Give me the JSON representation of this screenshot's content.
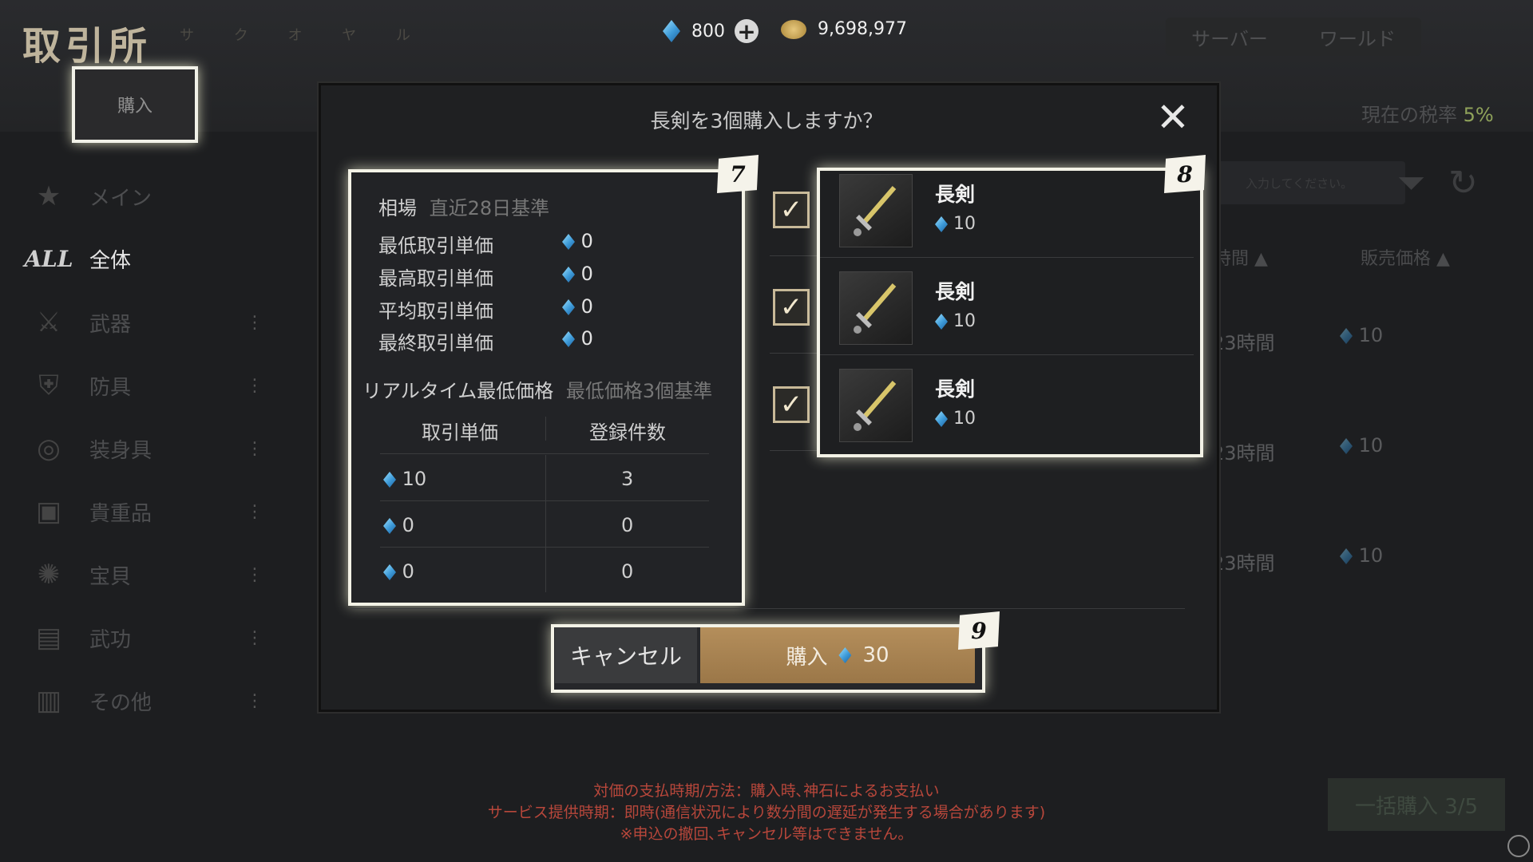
{
  "header": {
    "title": "取引所",
    "subglyph": "サ ク オ ヤ ル",
    "gems": "800",
    "gold": "9,698,977",
    "server_tab": "サーバー",
    "world_tab": "ワールド",
    "tax_label": "現在の税率",
    "tax_value": "5%"
  },
  "buy_tab": "購入",
  "sidebar": {
    "items": [
      {
        "label": "メイン",
        "icon": "star-icon"
      },
      {
        "label": "全体",
        "icon": "all-icon",
        "icon_text": "ALL"
      },
      {
        "label": "武器",
        "icon": "sword-icon"
      },
      {
        "label": "防具",
        "icon": "armor-icon"
      },
      {
        "label": "装身具",
        "icon": "accessory-icon"
      },
      {
        "label": "貴重品",
        "icon": "valuables-icon"
      },
      {
        "label": "宝貝",
        "icon": "treasure-icon"
      },
      {
        "label": "武功",
        "icon": "martial-arts-icon"
      },
      {
        "label": "その他",
        "icon": "other-icon"
      }
    ]
  },
  "background": {
    "search_placeholder": "入力してください。",
    "col_time": "時間",
    "col_price": "販売価格",
    "rows": [
      {
        "time": "23時間",
        "price": "10"
      },
      {
        "time": "23時間",
        "price": "10"
      },
      {
        "time": "23時間",
        "price": "10"
      }
    ],
    "bulk_buy": "一括購入 3/5"
  },
  "modal": {
    "title": "長剣を3個購入しますか？",
    "market": {
      "heading": "相場",
      "heading_note": "直近28日基準",
      "stats": [
        {
          "label": "最低取引単価",
          "value": "0"
        },
        {
          "label": "最高取引単価",
          "value": "0"
        },
        {
          "label": "平均取引単価",
          "value": "0"
        },
        {
          "label": "最終取引単価",
          "value": "0"
        }
      ],
      "realtime_heading": "リアルタイム最低価格",
      "realtime_note": "最低価格3個基準",
      "table_headers": [
        "取引単価",
        "登録件数"
      ],
      "table_rows": [
        {
          "price": "10",
          "count": "3"
        },
        {
          "price": "0",
          "count": "0"
        },
        {
          "price": "0",
          "count": "0"
        }
      ]
    },
    "items": [
      {
        "name": "長剣",
        "price": "10",
        "checked": true
      },
      {
        "name": "長剣",
        "price": "10",
        "checked": true
      },
      {
        "name": "長剣",
        "price": "10",
        "checked": true
      }
    ],
    "cancel_label": "キャンセル",
    "buy_label": "購入",
    "buy_total": "30",
    "badges": [
      "7",
      "8",
      "9"
    ]
  },
  "notice": {
    "line1": "対価の支払時期/方法：購入時､神石によるお支払い",
    "line2": "サービス提供時期：即時(通信状況により数分間の遅延が発生する場合があります)",
    "line3": "※申込の撤回､キャンセル等はできません。"
  },
  "colors": {
    "accent_gold": "#b48e5b",
    "notice_red": "#b8473b",
    "highlight": "#f3f2e6",
    "tax_green": "#8fa25a"
  }
}
